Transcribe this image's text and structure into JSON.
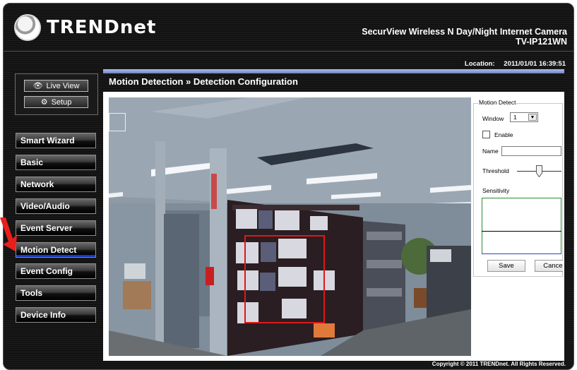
{
  "brand": {
    "logo_text": "TRENDnet"
  },
  "header": {
    "product_line1": "SecurView Wireless N Day/Night Internet Camera",
    "product_line2": "TV-IP121WN",
    "location_label": "Location:",
    "datetime": "2011/01/01 16:39:51"
  },
  "topnav": {
    "live_view": "Live View",
    "setup": "Setup"
  },
  "menu": {
    "items": [
      "Smart Wizard",
      "Basic",
      "Network",
      "Video/Audio",
      "Event Server",
      "Motion Detect",
      "Event Config",
      "Tools",
      "Device Info"
    ],
    "active": "Motion Detect"
  },
  "page": {
    "title": "Motion Detection » Detection Configuration"
  },
  "motion_panel": {
    "legend": "Motion Detect",
    "window_label": "Window",
    "window_value": "1",
    "enable_label": "Enable",
    "enable_checked": false,
    "name_label": "Name",
    "name_value": "",
    "threshold_label": "Threshold",
    "sensitivity_label": "Sensitivity",
    "save_label": "Save",
    "cancel_label": "Cancel"
  },
  "footer": {
    "copyright": "Copyright © 2011 TRENDnet. All Rights Reserved."
  },
  "colors": {
    "active_underline": "#1438c8",
    "detect_box": "#e01818",
    "arrow": "#e8201c"
  }
}
